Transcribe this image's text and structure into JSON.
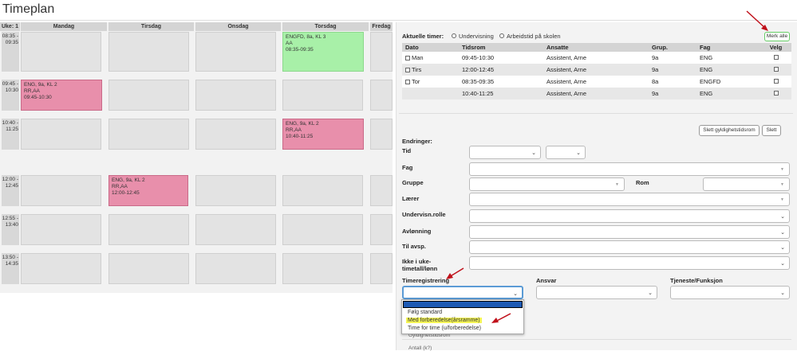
{
  "page": {
    "title": "Timeplan"
  },
  "calendar": {
    "week_label": "Uke: 1",
    "days": [
      "Mandag",
      "Tirsdag",
      "Onsdag",
      "Torsdag",
      "Fredag"
    ],
    "times": [
      "08:35 - 09:35",
      "09:45 - 10:30",
      "10:40 - 11:25",
      "12:00 - 12:45",
      "12:55 - 13:40",
      "13:50 - 14:35"
    ],
    "events": [
      {
        "day": "Torsdag",
        "lines": [
          "ENGFD, 8a, KL 3",
          "AA",
          "08:35-09:35"
        ],
        "color": "#a8f0a8"
      },
      {
        "day": "Mandag",
        "lines": [
          "ENG, 9a, KL 2",
          "RR,AA",
          "09:45-10:30"
        ],
        "color": "#e88fab"
      },
      {
        "day": "Torsdag",
        "lines": [
          "ENG, 9a, KL 2",
          "RR,AA",
          "10:40-11:25"
        ],
        "color": "#e88fab"
      },
      {
        "day": "Tirsdag",
        "lines": [
          "ENG, 9a, KL 2",
          "RR,AA",
          "12:00-12:45"
        ],
        "color": "#e88fab"
      }
    ]
  },
  "panel": {
    "current_label": "Aktuelle timer:",
    "radio1": "Undervisning",
    "radio2": "Arbeidstid på skolen",
    "mark_all": "Merk alle",
    "table": {
      "headers": [
        "Dato",
        "Tidsrom",
        "Ansatte",
        "Grup.",
        "Fag",
        "Velg"
      ],
      "rows": [
        {
          "dato": "Man",
          "tidsrom": "09:45-10:30",
          "ansatte": "Assistent, Arne",
          "grup": "9a",
          "fag": "ENG"
        },
        {
          "dato": "Tirs",
          "tidsrom": "12:00-12:45",
          "ansatte": "Assistent, Arne",
          "grup": "9a",
          "fag": "ENG"
        },
        {
          "dato": "Tor",
          "tidsrom": "08:35-09:35",
          "ansatte": "Assistent, Arne",
          "grup": "8a",
          "fag": "ENGFD"
        },
        {
          "dato": "",
          "tidsrom": "10:40-11:25",
          "ansatte": "Assistent, Arne",
          "grup": "9a",
          "fag": "ENG"
        }
      ]
    },
    "btn_delete_range": "Slett gyldighetstidsrom",
    "btn_delete": "Slett",
    "changes_label": "Endringer:",
    "fields": {
      "tid": "Tid",
      "fag": "Fag",
      "gruppe": "Gruppe",
      "rom": "Rom",
      "laerer": "Lærer",
      "undervisn": "Undervisn.rolle",
      "avlonning": "Avlønning",
      "til_avsp": "Til avsp.",
      "ikke_i_uke_1": "Ikke i uke-",
      "ikke_i_uke_2": "timetall/lønn",
      "timereg": "Timeregistrering",
      "ansvar": "Ansvar",
      "tjeneste": "Tjeneste/Funksjon"
    },
    "dropdown_options": [
      "Følg standard",
      "Med forberedelse(årsramme)",
      "Time for time (u/forberedelse)"
    ],
    "below_text_1": "Gyldighetstidsrom",
    "below_text_2": "Antall (k?)"
  },
  "colors": {
    "pink_event": "#e88fab",
    "green_event": "#a8f0a8",
    "red_arrow": "#c0101a",
    "highlight": "#f5f556",
    "selected_blue": "#1e5ab4"
  }
}
